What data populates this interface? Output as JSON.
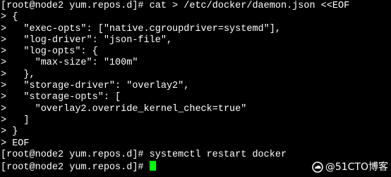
{
  "terminal": {
    "lines": [
      "[root@node2 yum.repos.d]# cat > /etc/docker/daemon.json <<EOF",
      "> {",
      ">   \"exec-opts\": [\"native.cgroupdriver=systemd\"],",
      ">   \"log-driver\": \"json-file\",",
      ">   \"log-opts\": {",
      ">     \"max-size\": \"100m\"",
      ">   },",
      ">   \"storage-driver\": \"overlay2\",",
      ">   \"storage-opts\": [",
      ">     \"overlay2.override_kernel_check=true\"",
      ">   ]",
      "> }",
      "> EOF",
      "[root@node2 yum.repos.d]# systemctl restart docker"
    ],
    "prompt": "[root@node2 yum.repos.d]# "
  },
  "colors": {
    "background": "#000000",
    "foreground": "#ffffff",
    "cursor": "#00ff00"
  },
  "watermark": {
    "text": "@51CTO博客",
    "icon": "cloud-logo-icon"
  }
}
